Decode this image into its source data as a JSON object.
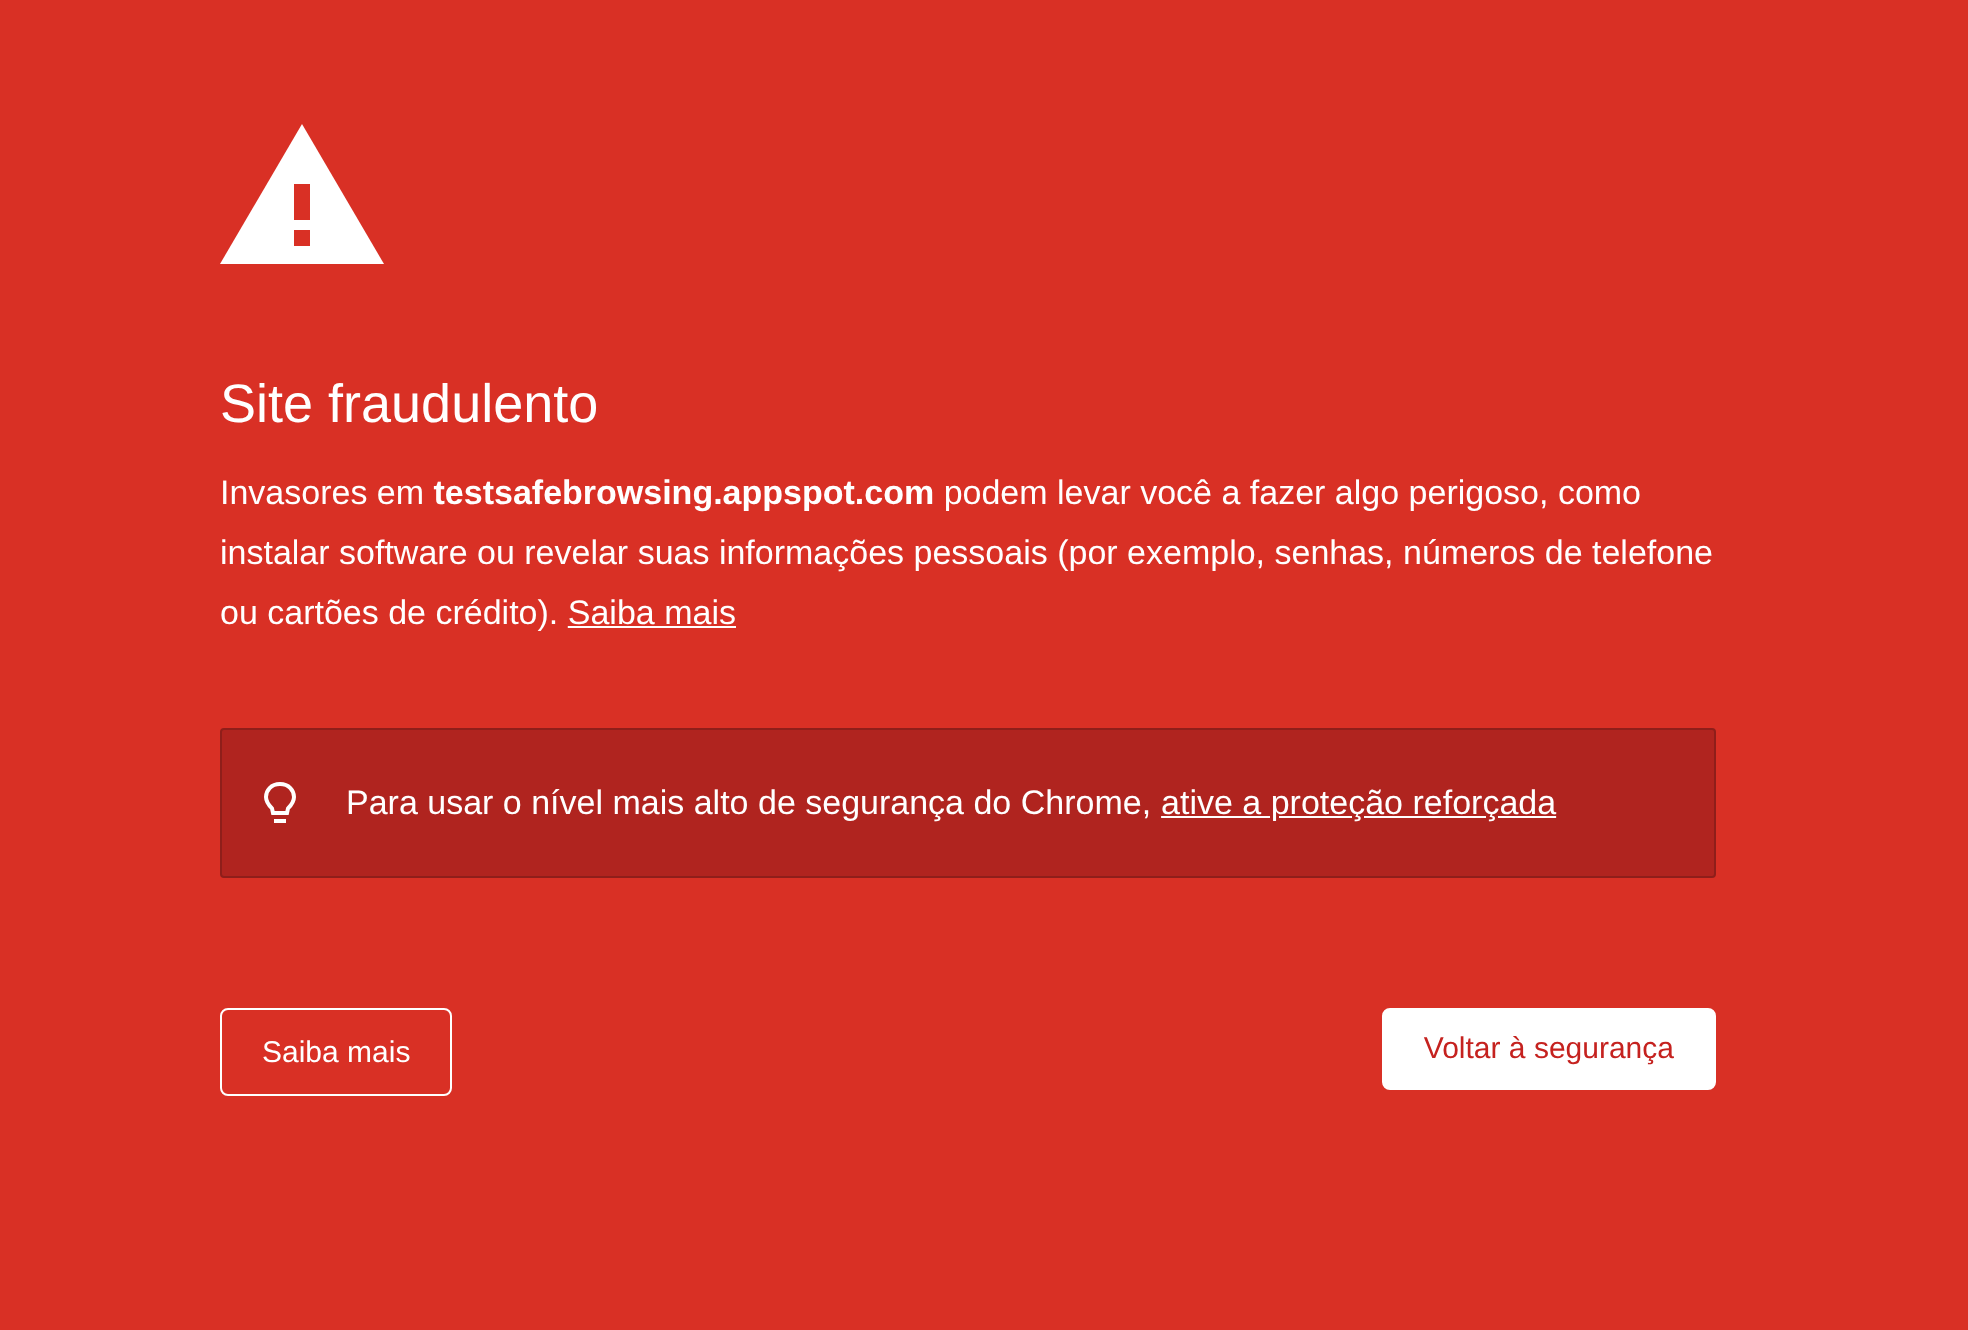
{
  "title": "Site fraudulento",
  "message": {
    "text": "Invasores em **testsafebrowsing.appspot.com** podem levar você a fazer algo perigoso, como instalar software ou revelar suas informações pessoais (por exemplo, senhas, números de telefone ou cartões de crédito).",
    "link": "Saiba mais"
  },
  "notice": {
    "text": "Para usar o nível mais alto de segurança do Chrome,",
    "link": "ative a proteção reforçada"
  },
  "buttons": [
    {
      "label": "Saiba mais",
      "kind": "secondary"
    },
    {
      "label": "Voltar à segurança",
      "kind": "primary"
    }
  ]
}
